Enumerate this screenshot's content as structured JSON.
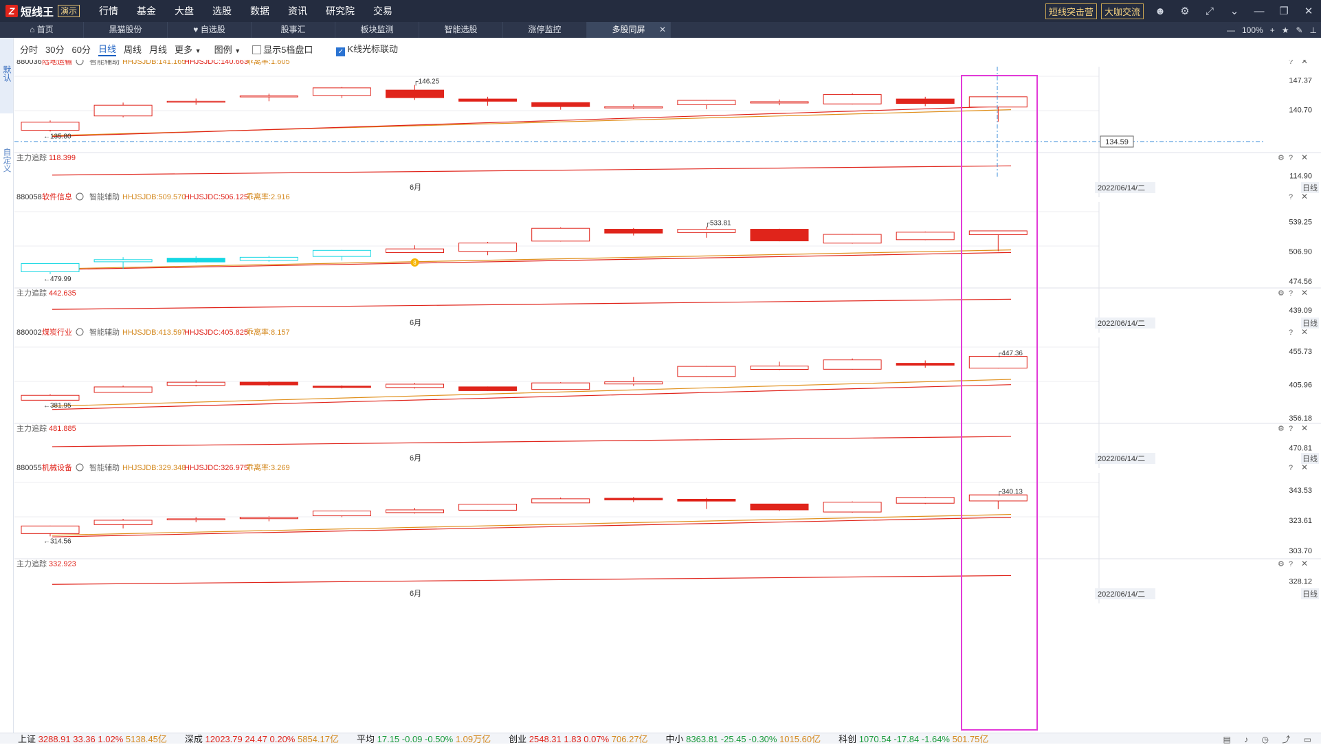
{
  "app": {
    "name": "短线王",
    "badge": "演示"
  },
  "menu": [
    "行情",
    "基金",
    "大盘",
    "选股",
    "数据",
    "资讯",
    "研究院",
    "交易"
  ],
  "top_buttons": [
    "短线突击营",
    "大咖交流"
  ],
  "tabs": [
    {
      "label": "首页",
      "icon": "home-icon"
    },
    {
      "label": "黑猫股份"
    },
    {
      "label": "自选股",
      "icon": "heart-icon"
    },
    {
      "label": "股事汇"
    },
    {
      "label": "板块监测"
    },
    {
      "label": "智能选股"
    },
    {
      "label": "涨停监控"
    },
    {
      "label": "多股同屏",
      "active": true
    }
  ],
  "zoom": "100%",
  "sidebar": {
    "items": [
      "默认",
      "自定义"
    ]
  },
  "toolbar": {
    "periods": [
      "分时",
      "30分",
      "60分",
      "日线",
      "周线",
      "月线"
    ],
    "active_period": "日线",
    "more": "更多",
    "legend": "图例",
    "show5": "显示5档盘口",
    "link_cursor": "K线光标联动",
    "link_cursor_checked": true
  },
  "highlight_color": "#e23ad8",
  "colors": {
    "up": "#e0241b",
    "down": "#14d7e3",
    "ma1": "#e0901d",
    "ma2": "#e0241b"
  },
  "chart_data": [
    {
      "type": "candlestick",
      "code": "880036",
      "name": "陆地运输",
      "assist": "智能辅助",
      "indicators": [
        "HHJSJDB:141.165",
        "HHJSJDC:140.663",
        "乖离率:1.605"
      ],
      "ylim": [
        131.7,
        148.2
      ],
      "y_ticks": [
        "147.37",
        "140.70",
        "134.59"
      ],
      "candles": [
        {
          "o": 136.1,
          "c": 137.9,
          "h": 138.3,
          "l": 135.8,
          "hollow": true
        },
        {
          "o": 139.3,
          "c": 141.7,
          "h": 142.3,
          "l": 139.0,
          "hollow": true
        },
        {
          "o": 142.5,
          "c": 142.6,
          "h": 143.2,
          "l": 141.8,
          "hollow": true
        },
        {
          "o": 143.6,
          "c": 143.8,
          "h": 144.3,
          "l": 142.6,
          "hollow": true
        },
        {
          "o": 143.9,
          "c": 145.6,
          "h": 145.8,
          "l": 143.3,
          "hollow": true
        },
        {
          "o": 145.1,
          "c": 143.4,
          "h": 146.25,
          "l": 142.9,
          "hollow": false
        },
        {
          "o": 143.1,
          "c": 142.6,
          "h": 143.6,
          "l": 141.6,
          "hollow": false
        },
        {
          "o": 142.3,
          "c": 141.4,
          "h": 142.3,
          "l": 140.7,
          "hollow": false
        },
        {
          "o": 141.1,
          "c": 141.4,
          "h": 141.9,
          "l": 140.8,
          "hollow": true
        },
        {
          "o": 141.8,
          "c": 142.8,
          "h": 142.9,
          "l": 140.8,
          "hollow": true
        },
        {
          "o": 142.2,
          "c": 142.5,
          "h": 143.0,
          "l": 141.7,
          "hollow": true
        },
        {
          "o": 142.0,
          "c": 144.1,
          "h": 144.4,
          "l": 141.9,
          "hollow": true
        },
        {
          "o": 143.1,
          "c": 142.1,
          "h": 143.6,
          "l": 141.5,
          "hollow": false
        },
        {
          "o": 141.3,
          "c": 143.6,
          "h": 143.6,
          "l": 138.0,
          "hollow": true
        }
      ],
      "ma1": [
        [
          0.35,
          134.9
        ],
        [
          1450,
          140.7
        ]
      ],
      "ma2": [
        [
          0.35,
          134.7
        ],
        [
          1450,
          141.5
        ]
      ],
      "max_label": "146.25",
      "min_label": "135.80",
      "cursor_value": "134.59",
      "sub": {
        "label": "主力追踪",
        "value": "118.399",
        "ylim": [
          112.5,
          122.0
        ],
        "y_ticks": [
          "114.90"
        ],
        "line": [
          115.2,
          119.6
        ]
      },
      "month_label": "6月",
      "date_label": "2022/06/14/二",
      "period_tag": "日线"
    },
    {
      "type": "candlestick",
      "code": "880058",
      "name": "软件信息",
      "assist": "智能辅助",
      "indicators": [
        "HHJSJDB:509.570",
        "HHJSJDC:506.125",
        "乖离率:2.916"
      ],
      "ylim": [
        470.0,
        550.0
      ],
      "y_ticks": [
        "539.25",
        "506.90",
        "474.56"
      ],
      "candles": [
        {
          "o": 484.6,
          "c": 493.6,
          "h": 493.8,
          "l": 482.0,
          "hollow": true,
          "down": true
        },
        {
          "o": 495.5,
          "c": 497.8,
          "h": 500.5,
          "l": 487.6,
          "hollow": true,
          "down": true
        },
        {
          "o": 495.3,
          "c": 499.4,
          "h": 501.6,
          "l": 494.4,
          "hollow": false,
          "down": true
        },
        {
          "o": 497.0,
          "c": 500.4,
          "h": 502.0,
          "l": 495.6,
          "hollow": true,
          "down": true
        },
        {
          "o": 501.3,
          "c": 507.9,
          "h": 508.4,
          "l": 496.9,
          "hollow": true,
          "down": true
        },
        {
          "o": 505.5,
          "c": 509.5,
          "h": 513.4,
          "l": 505.4,
          "hollow": true
        },
        {
          "o": 506.8,
          "c": 515.9,
          "h": 517.1,
          "l": 502.7,
          "hollow": true
        },
        {
          "o": 518.0,
          "c": 531.9,
          "h": 533.0,
          "l": 517.5,
          "hollow": true
        },
        {
          "o": 530.9,
          "c": 526.7,
          "h": 532.2,
          "l": 524.1,
          "hollow": false
        },
        {
          "o": 527.3,
          "c": 530.8,
          "h": 533.81,
          "l": 521.7,
          "hollow": true
        },
        {
          "o": 530.9,
          "c": 518.2,
          "h": 531.5,
          "l": 517.8,
          "hollow": false
        },
        {
          "o": 515.8,
          "c": 525.3,
          "h": 525.8,
          "l": 515.2,
          "hollow": true
        },
        {
          "o": 519.5,
          "c": 527.7,
          "h": 528.4,
          "l": 519.0,
          "hollow": true
        },
        {
          "o": 525.0,
          "c": 529.1,
          "h": 529.2,
          "l": 507.0,
          "hollow": true
        }
      ],
      "ma1": [
        [
          0.35,
          487.8
        ],
        [
          1450,
          508.4
        ]
      ],
      "ma2": [
        [
          0.35,
          487.0
        ],
        [
          1450,
          505.6
        ]
      ],
      "max_label": "533.81",
      "min_label": "479.99",
      "marker": {
        "index": 5,
        "value": 494.8,
        "label": "8"
      },
      "sub": {
        "label": "主力追踪",
        "value": "442.635",
        "ylim": [
          436.0,
          446.0
        ],
        "y_ticks": [
          "439.09"
        ],
        "line": [
          439.4,
          444.5
        ]
      },
      "month_label": "6月",
      "date_label": "2022/06/14/二",
      "period_tag": "日线"
    },
    {
      "type": "candlestick",
      "code": "880002",
      "name": "煤炭行业",
      "assist": "智能辅助",
      "indicators": [
        "HHJSJDB:413.597",
        "HHJSJDC:405.825",
        "乖离率:8.157"
      ],
      "ylim": [
        352.0,
        462.0
      ],
      "y_ticks": [
        "455.73",
        "405.96",
        "356.18"
      ],
      "candles": [
        {
          "o": 382.5,
          "c": 389.8,
          "h": 391.5,
          "l": 381.95,
          "hollow": true
        },
        {
          "o": 394.2,
          "c": 402.4,
          "h": 404.5,
          "l": 394.0,
          "hollow": true
        },
        {
          "o": 404.7,
          "c": 409.4,
          "h": 412.5,
          "l": 403.2,
          "hollow": true
        },
        {
          "o": 409.5,
          "c": 405.4,
          "h": 410.7,
          "l": 403.8,
          "hollow": false
        },
        {
          "o": 403.6,
          "c": 401.6,
          "h": 404.8,
          "l": 400.1,
          "hollow": false
        },
        {
          "o": 401.5,
          "c": 406.5,
          "h": 408.4,
          "l": 399.9,
          "hollow": true
        },
        {
          "o": 402.5,
          "c": 396.8,
          "h": 403.0,
          "l": 396.3,
          "hollow": false
        },
        {
          "o": 398.6,
          "c": 408.4,
          "h": 409.5,
          "l": 398.2,
          "hollow": true
        },
        {
          "o": 406.8,
          "c": 410.0,
          "h": 417.2,
          "l": 403.8,
          "hollow": true
        },
        {
          "o": 418.0,
          "c": 433.1,
          "h": 433.8,
          "l": 417.6,
          "hollow": true
        },
        {
          "o": 428.6,
          "c": 433.6,
          "h": 440.2,
          "l": 427.4,
          "hollow": true
        },
        {
          "o": 428.8,
          "c": 442.8,
          "h": 444.9,
          "l": 428.3,
          "hollow": true
        },
        {
          "o": 437.7,
          "c": 434.9,
          "h": 442.0,
          "l": 431.2,
          "hollow": false
        },
        {
          "o": 430.5,
          "c": 448.0,
          "h": 447.36,
          "l": 430.0,
          "hollow": true
        }
      ],
      "ma1": [
        [
          0.35,
          373.6
        ],
        [
          1450,
          413.7
        ]
      ],
      "ma2": [
        [
          0.35,
          368.7
        ],
        [
          1450,
          405.8
        ]
      ],
      "max_label": "447.36",
      "min_label": "381.95",
      "sub": {
        "label": "主力追踪",
        "value": "481.885",
        "ylim": [
          466.0,
          491.0
        ],
        "y_ticks": [
          "470.81"
        ],
        "line": [
          472.1,
          484.9
        ]
      },
      "month_label": "6月",
      "date_label": "2022/06/14/二",
      "period_tag": "日线"
    },
    {
      "type": "candlestick",
      "code": "880055",
      "name": "机械设备",
      "assist": "智能辅助",
      "indicators": [
        "HHJSJDB:329.348",
        "HHJSJDC:326.975",
        "乖离率:3.269"
      ],
      "ylim": [
        300.0,
        348.5
      ],
      "y_ticks": [
        "343.53",
        "323.61",
        "303.70"
      ],
      "candles": [
        {
          "o": 314.8,
          "c": 319.8,
          "h": 320.0,
          "l": 313.0,
          "hollow": true
        },
        {
          "o": 320.7,
          "c": 323.6,
          "h": 324.5,
          "l": 318.2,
          "hollow": true
        },
        {
          "o": 323.9,
          "c": 324.5,
          "h": 325.6,
          "l": 322.3,
          "hollow": true
        },
        {
          "o": 324.6,
          "c": 325.6,
          "h": 326.2,
          "l": 322.9,
          "hollow": true
        },
        {
          "o": 326.5,
          "c": 329.7,
          "h": 330.0,
          "l": 325.6,
          "hollow": true
        },
        {
          "o": 328.6,
          "c": 330.4,
          "h": 331.7,
          "l": 328.0,
          "hollow": true
        },
        {
          "o": 330.2,
          "c": 334.2,
          "h": 334.4,
          "l": 330.0,
          "hollow": true
        },
        {
          "o": 335.0,
          "c": 337.7,
          "h": 338.6,
          "l": 334.9,
          "hollow": true
        },
        {
          "o": 338.1,
          "c": 337.0,
          "h": 338.9,
          "l": 335.6,
          "hollow": false
        },
        {
          "o": 337.4,
          "c": 336.2,
          "h": 338.3,
          "l": 331.0,
          "hollow": false
        },
        {
          "o": 334.3,
          "c": 330.4,
          "h": 334.3,
          "l": 329.7,
          "hollow": false
        },
        {
          "o": 329.0,
          "c": 335.5,
          "h": 336.0,
          "l": 328.6,
          "hollow": true
        },
        {
          "o": 334.8,
          "c": 338.6,
          "h": 339.0,
          "l": 334.3,
          "hollow": true
        },
        {
          "o": 336.3,
          "c": 340.3,
          "h": 340.13,
          "l": 330.9,
          "hollow": true
        }
      ],
      "ma1": [
        [
          0.35,
          313.7
        ],
        [
          1450,
          327.4
        ]
      ],
      "ma2": [
        [
          0.35,
          312.6
        ],
        [
          1450,
          325.5
        ]
      ],
      "max_label": "340.13",
      "min_label": "314.56",
      "sub": {
        "label": "主力追踪",
        "value": "332.923",
        "ylim": [
          324.0,
          338.0
        ],
        "y_ticks": [
          "328.12"
        ],
        "line": [
          325.8,
          332.0
        ]
      },
      "month_label": "6月",
      "date_label": "2022/06/14/二",
      "period_tag": "日线"
    }
  ],
  "status_bar": [
    {
      "name": "上证",
      "value": "3288.91",
      "change": "33.36",
      "pct": "1.02%",
      "amount": "5138.45亿",
      "dir": "up"
    },
    {
      "name": "深成",
      "value": "12023.79",
      "change": "24.47",
      "pct": "0.20%",
      "amount": "5854.17亿",
      "dir": "up"
    },
    {
      "name": "平均",
      "value": "17.15",
      "change": "-0.09",
      "pct": "-0.50%",
      "amount": "1.09万亿",
      "dir": "dn"
    },
    {
      "name": "创业",
      "value": "2548.31",
      "change": "1.83",
      "pct": "0.07%",
      "amount": "706.27亿",
      "dir": "up"
    },
    {
      "name": "中小",
      "value": "8363.81",
      "change": "-25.45",
      "pct": "-0.30%",
      "amount": "1015.60亿",
      "dir": "dn"
    },
    {
      "name": "科创",
      "value": "1070.54",
      "change": "-17.84",
      "pct": "-1.64%",
      "amount": "501.75亿",
      "dir": "dn"
    }
  ]
}
